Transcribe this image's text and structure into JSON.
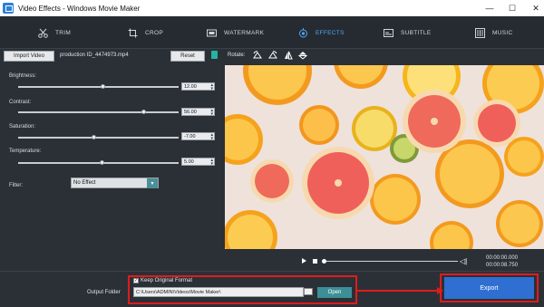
{
  "window": {
    "title": "Video Effects - Windows Movie Maker",
    "min_glyph": "—",
    "max_glyph": "☐",
    "close_glyph": "✕"
  },
  "tabs": [
    {
      "label": "TRIM",
      "icon": "scissors-icon",
      "active": false
    },
    {
      "label": "CROP",
      "icon": "crop-icon",
      "active": false
    },
    {
      "label": "WATERMARK",
      "icon": "watermark-icon",
      "active": false
    },
    {
      "label": "EFFECTS",
      "icon": "effects-icon",
      "active": true
    },
    {
      "label": "SUBTITLE",
      "icon": "subtitle-icon",
      "active": false
    },
    {
      "label": "MUSIC",
      "icon": "music-icon",
      "active": false
    }
  ],
  "toolbar": {
    "import_label": "Import Video",
    "filename": "production ID_4474973.mp4",
    "reset_label": "Reset",
    "rotate_label": "Rotate:"
  },
  "adjustments": [
    {
      "label": "Brightness:",
      "value": "12.00",
      "level": 0.53
    },
    {
      "label": "Contrast:",
      "value": "56.00",
      "level": 0.78
    },
    {
      "label": "Saturation:",
      "value": "-7.00",
      "level": 0.47
    },
    {
      "label": "Temperature:",
      "value": "5.00",
      "level": 0.52
    }
  ],
  "filter": {
    "label": "Filter:",
    "selected": "No Effect"
  },
  "playback": {
    "current_time": "00:00:00.000",
    "total_time": "00:00:08.750",
    "progress": 0.0
  },
  "output": {
    "folder_label": "Output Folder",
    "keep_format_label": "Keep Original Format",
    "keep_format_checked": true,
    "path": "C:\\Users\\ADMIN\\Videos\\Movie Maker\\",
    "open_label": "Open",
    "export_label": "Export"
  },
  "colors": {
    "accent": "#2f6fd1",
    "teal": "#3c8f96",
    "highlight_red": "#e01b1b",
    "active_tab": "#4fa8ff"
  }
}
